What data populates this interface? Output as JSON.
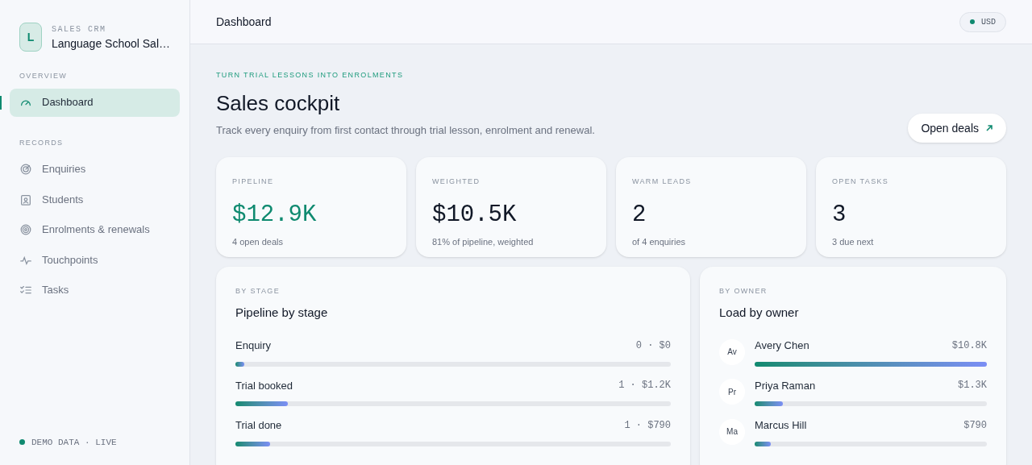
{
  "brand": {
    "initial": "L",
    "eyebrow": "SALES CRM",
    "name": "Language School Sal…"
  },
  "sidebar": {
    "sections": [
      {
        "title": "OVERVIEW",
        "items": [
          {
            "label": "Dashboard",
            "selected": true
          }
        ]
      },
      {
        "title": "RECORDS",
        "items": [
          {
            "label": "Enquiries",
            "selected": false
          },
          {
            "label": "Students",
            "selected": false
          },
          {
            "label": "Enrolments & renewals",
            "selected": false
          },
          {
            "label": "Touchpoints",
            "selected": false
          },
          {
            "label": "Tasks",
            "selected": false
          }
        ]
      }
    ],
    "footer": "DEMO DATA · LIVE"
  },
  "header": {
    "title": "Dashboard",
    "currency": "USD"
  },
  "hero": {
    "eyebrow": "TURN TRIAL LESSONS INTO ENROLMENTS",
    "title": "Sales cockpit",
    "subtitle": "Track every enquiry from first contact through trial lesson, enrolment and renewal.",
    "button": "Open deals"
  },
  "stats": [
    {
      "label": "PIPELINE",
      "value": "$12.9K",
      "note": "4 open deals",
      "highlight": true
    },
    {
      "label": "WEIGHTED",
      "value": "$10.5K",
      "note": "81% of pipeline, weighted",
      "highlight": false
    },
    {
      "label": "WARM LEADS",
      "value": "2",
      "note": "of 4 enquiries",
      "highlight": false
    },
    {
      "label": "OPEN TASKS",
      "value": "3",
      "note": "3 due next",
      "highlight": false
    }
  ],
  "stage_panel": {
    "eyebrow": "BY STAGE",
    "title": "Pipeline by stage",
    "rows": [
      {
        "label": "Enquiry",
        "reading": "0 · $0",
        "level": 0.02
      },
      {
        "label": "Trial booked",
        "reading": "1 · $1.2K",
        "level": 0.12
      },
      {
        "label": "Trial done",
        "reading": "1 · $790",
        "level": 0.08
      }
    ]
  },
  "owner_panel": {
    "eyebrow": "BY OWNER",
    "title": "Load by owner",
    "rows": [
      {
        "initials": "Av",
        "name": "Avery Chen",
        "reading": "$10.8K",
        "level": 1
      },
      {
        "initials": "Pr",
        "name": "Priya Raman",
        "reading": "$1.3K",
        "level": 0.12
      },
      {
        "initials": "Ma",
        "name": "Marcus Hill",
        "reading": "$790",
        "level": 0.07
      }
    ]
  }
}
